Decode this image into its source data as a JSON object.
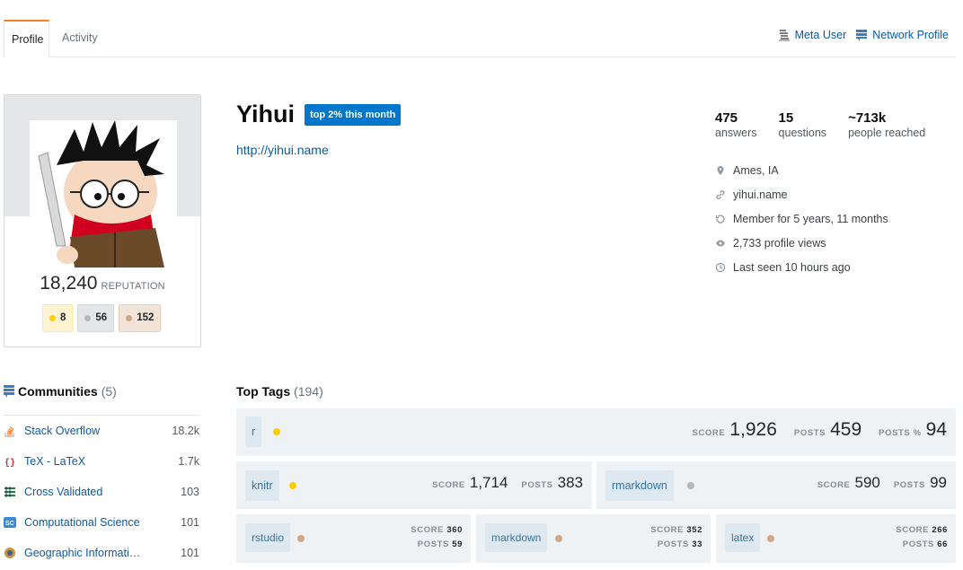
{
  "tabs": {
    "profile": "Profile",
    "activity": "Activity"
  },
  "toplinks": {
    "meta_user": "Meta User",
    "network_profile": "Network Profile"
  },
  "profile": {
    "name": "Yihui",
    "top_badge": "top 2% this month",
    "website": "http://yihui.name",
    "reputation": "18,240",
    "reputation_label": "REPUTATION",
    "badges": {
      "gold": "8",
      "silver": "56",
      "bronze": "152"
    }
  },
  "stats": [
    {
      "value": "475",
      "label": "answers"
    },
    {
      "value": "15",
      "label": "questions"
    },
    {
      "value": "~713k",
      "label": "people reached"
    }
  ],
  "info": {
    "location": "Ames, IA",
    "site": "yihui.name",
    "member": "Member for 5 years, 11 months",
    "views": "2,733 profile views",
    "seen": "Last seen 10 hours ago"
  },
  "communities": {
    "title": "Communities",
    "count": "(5)",
    "items": [
      {
        "name": "Stack Overflow",
        "rep": "18.2k"
      },
      {
        "name": "TeX - LaTeX",
        "rep": "1.7k"
      },
      {
        "name": "Cross Validated",
        "rep": "103"
      },
      {
        "name": "Computational Science",
        "rep": "101"
      },
      {
        "name": "Geographic Informati…",
        "rep": "101"
      }
    ]
  },
  "top_tags": {
    "title": "Top Tags",
    "count": "(194)",
    "labels": {
      "score": "SCORE",
      "posts": "POSTS",
      "posts_pct": "POSTS %"
    },
    "tags": [
      {
        "name": "r",
        "score": "1,926",
        "posts": "459",
        "posts_pct": "94",
        "badge_color": "#ffcc01"
      },
      {
        "name": "knitr",
        "score": "1,714",
        "posts": "383",
        "badge_color": "#ffcc01"
      },
      {
        "name": "rmarkdown",
        "score": "590",
        "posts": "99",
        "badge_color": "#b4b8bc"
      },
      {
        "name": "rstudio",
        "score": "360",
        "posts": "59",
        "badge_color": "#d1a684"
      },
      {
        "name": "markdown",
        "score": "352",
        "posts": "33",
        "badge_color": "#d1a684"
      },
      {
        "name": "latex",
        "score": "266",
        "posts": "66",
        "badge_color": "#d1a684"
      }
    ]
  },
  "colors": {
    "link": "#0c5aa6",
    "accent": "#f48024",
    "tag_bg": "#dde8f1",
    "tag_text": "#39739d"
  }
}
